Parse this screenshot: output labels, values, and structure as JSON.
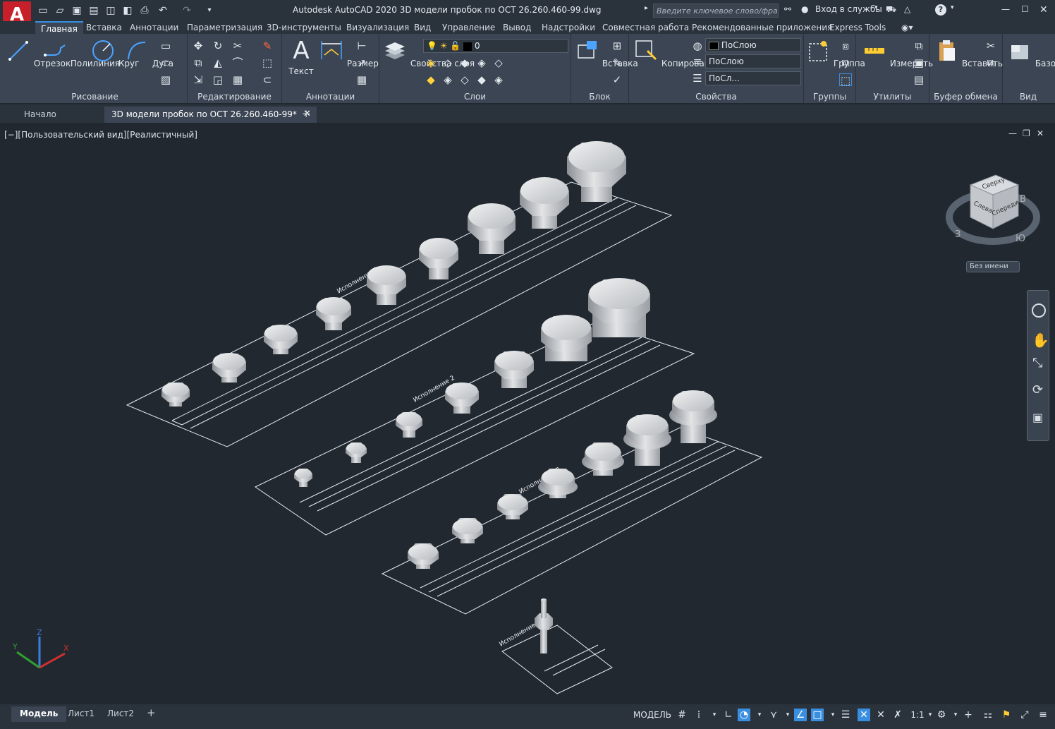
{
  "app": {
    "logo_letter": "A",
    "title": "Autodesk AutoCAD 2020   3D модели пробок по ОСТ 26.260.460-99.dwg"
  },
  "titlebar": {
    "search_placeholder": "Введите ключевое слово/фразу",
    "login_label": "Вход в службы",
    "help_label": "?"
  },
  "ribbon_tabs": [
    "Главная",
    "Вставка",
    "Аннотации",
    "Параметризация",
    "3D-инструменты",
    "Визуализация",
    "Вид",
    "Управление",
    "Вывод",
    "Надстройки",
    "Совместная работа",
    "Рекомендованные приложения",
    "Express Tools"
  ],
  "ribbon": {
    "draw": {
      "title": "Рисование",
      "line": "Отрезок",
      "polyline": "Полилиния",
      "circle": "Круг",
      "arc": "Дуга"
    },
    "modify": {
      "title": "Редактирование"
    },
    "annotation": {
      "title": "Аннотации",
      "text": "Текст",
      "dimension": "Размер"
    },
    "layers": {
      "title": "Слои",
      "props": "Свойства слоя",
      "current_layer": "0"
    },
    "block": {
      "title": "Блок",
      "insert": "Вставка"
    },
    "properties": {
      "title": "Свойства",
      "match": "Копирование свойств",
      "color": "ПоСлою",
      "linetype": "ПоСлою",
      "lineweight": "ПоСл..."
    },
    "groups": {
      "title": "Группы",
      "group": "Группа"
    },
    "utilities": {
      "title": "Утилиты",
      "measure": "Измерить"
    },
    "clipboard": {
      "title": "Буфер обмена",
      "paste": "Вставить"
    },
    "view": {
      "title": "Вид",
      "base": "Базовый"
    }
  },
  "doc_tabs": {
    "start": "Начало",
    "active": "3D модели пробок по ОСТ 26.260.460-99*"
  },
  "viewport": {
    "label": "[−][Пользовательский вид][Реалистичный]",
    "viewcube": {
      "top": "Сверху",
      "left": "Слева",
      "front": "Спереди",
      "compass_b": "В",
      "compass_yu": "Ю",
      "compass_z": "З"
    },
    "ucs_name": "Без имени",
    "labels": {
      "row1_title": "Исполнение 1",
      "row2_title": "Исполнение 2",
      "row3_title": "Исполнение 3",
      "row4_title": "Исполнение 4"
    }
  },
  "layout_tabs": [
    "Модель",
    "Лист1",
    "Лист2"
  ],
  "statusbar": {
    "model_label": "МОДЕЛЬ",
    "scale": "1:1"
  },
  "colors": {
    "accent": "#3a8ee0",
    "logo_red": "#c8202a",
    "background": "#212830"
  }
}
